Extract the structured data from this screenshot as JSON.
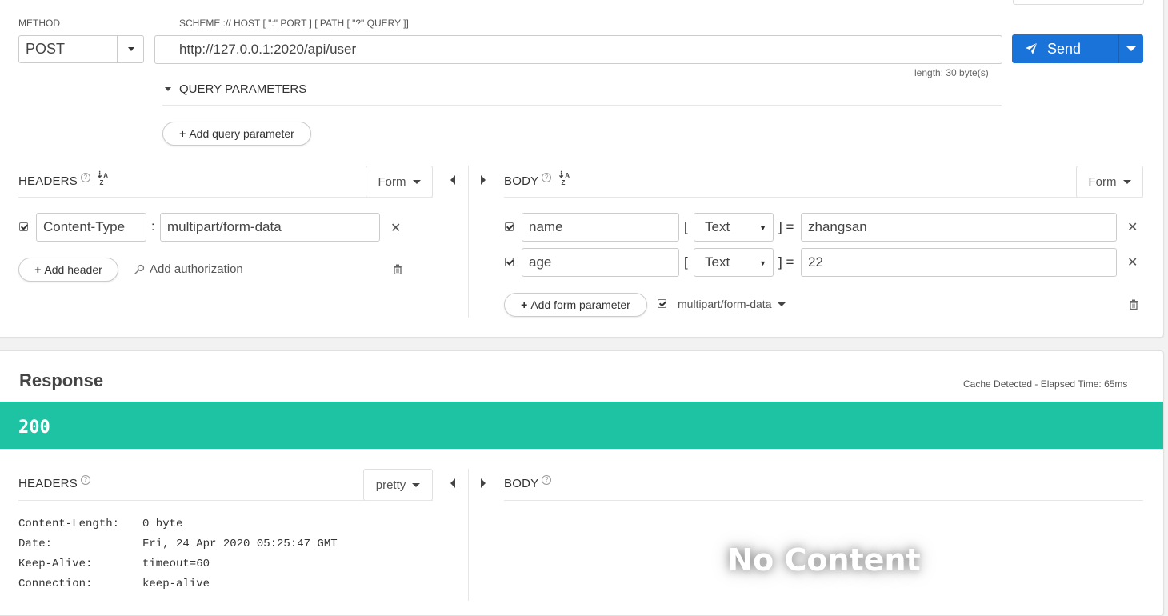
{
  "request": {
    "method_label": "METHOD",
    "method_value": "POST",
    "url_hint": "SCHEME :// HOST [ \":\" PORT ] [ PATH [ \"?\" QUERY ]]",
    "url_value": "http://127.0.0.1:2020/api/user",
    "length_text": "length: 30 byte(s)",
    "send_label": "Send",
    "query_params_label": "QUERY PARAMETERS",
    "add_query_label": "Add query parameter"
  },
  "req_headers": {
    "title": "HEADERS",
    "mode": "Form",
    "items": [
      {
        "key": "Content-Type",
        "value": "multipart/form-data"
      }
    ],
    "add_header_label": "Add header",
    "add_auth_label": "Add authorization"
  },
  "req_body": {
    "title": "BODY",
    "mode": "Form",
    "items": [
      {
        "key": "name",
        "type": "Text",
        "value": "zhangsan"
      },
      {
        "key": "age",
        "type": "Text",
        "value": "22"
      }
    ],
    "add_form_label": "Add form parameter",
    "content_type": "multipart/form-data"
  },
  "response": {
    "title": "Response",
    "cache_text": "Cache Detected - Elapsed Time: 65ms",
    "status": "200",
    "status_color": "#1ec3a3",
    "headers_title": "HEADERS",
    "headers_mode": "pretty",
    "body_title": "BODY",
    "headers": [
      {
        "name": "Content-Length:",
        "value": "0 byte"
      },
      {
        "name": "Date:",
        "value": "Fri, 24 Apr 2020 05:25:47 GMT"
      },
      {
        "name": "Keep-Alive:",
        "value": "timeout=60"
      },
      {
        "name": "Connection:",
        "value": "keep-alive"
      }
    ],
    "no_content": "No Content"
  },
  "colors": {
    "send_button": "#1a73d9",
    "status_bar": "#1ec3a3"
  }
}
